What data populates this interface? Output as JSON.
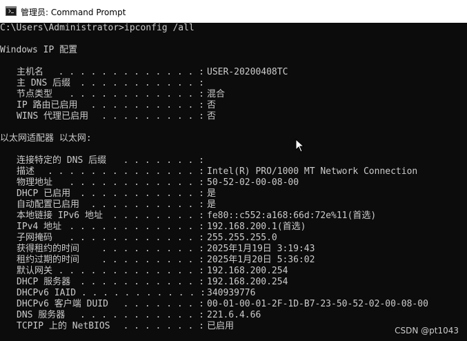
{
  "window": {
    "title": "管理员: Command Prompt",
    "icon": "cmd-icon"
  },
  "console": {
    "command_line": "C:\\Users\\Administrator>ipconfig /all",
    "windows_ip_header": "Windows IP 配置",
    "windows_ip_rows": [
      {
        "key": "主机名",
        "dots": " . . . . . . . . . . . . . :",
        "value": "USER-20200408TC"
      },
      {
        "key": "主 DNS 后缀",
        "dots": " . . . . . . . . . . . :",
        "value": ""
      },
      {
        "key": "节点类型",
        "dots": " . . . . . . . . . . . . :",
        "value": "混合"
      },
      {
        "key": "IP 路由已启用",
        "dots": " . . . . . . . . . . :",
        "value": "否"
      },
      {
        "key": "WINS 代理已启用",
        "dots": " . . . . . . . . . :",
        "value": "否"
      }
    ],
    "adapter_header": "以太网适配器 以太网:",
    "adapter_rows": [
      {
        "key": "连接特定的 DNS 后缀",
        "dots": " . . . . . . . :",
        "value": ""
      },
      {
        "key": "描述",
        "dots": ". . . . . . . . . . . . . . :",
        "value": "Intel(R) PRO/1000 MT Network Connection"
      },
      {
        "key": "物理地址",
        "dots": ". . . . . . . . . . . . :",
        "value": "50-52-02-00-08-00"
      },
      {
        "key": "DHCP 已启用",
        "dots": " . . . . . . . . . . . :",
        "value": "是"
      },
      {
        "key": "自动配置已启用",
        "dots": ". . . . . . . . . . :",
        "value": "是"
      },
      {
        "key": "本地链接 IPv6 地址",
        "dots": ". . . . . . . . :",
        "value": "fe80::c552:a168:66d:72e%11(首选)"
      },
      {
        "key": "IPv4 地址",
        "dots": " . . . . . . . . . . . . :",
        "value": "192.168.200.1(首选)"
      },
      {
        "key": "子网掩码",
        "dots": " . . . . . . . . . . . . :",
        "value": "255.255.255.0"
      },
      {
        "key": "获得租约的时间",
        "dots": " . . . . . . . . . :",
        "value": "2025年1月19日 3:19:43"
      },
      {
        "key": "租约过期的时间",
        "dots": " . . . . . . . . . :",
        "value": "2025年1月20日 5:36:02"
      },
      {
        "key": "默认网关",
        "dots": ". . . . . . . . . . . . . :",
        "value": "192.168.200.254"
      },
      {
        "key": "DHCP 服务器",
        "dots": " . . . . . . . . . . . :",
        "value": "192.168.200.254"
      },
      {
        "key": "DHCPv6 IAID",
        "dots": " . . . . . . . . . . . :",
        "value": "340939776"
      },
      {
        "key": "DHCPv6 客户端 DUID",
        "dots": " . . . . . . . :",
        "value": "00-01-00-01-2F-1D-B7-23-50-52-02-00-08-00"
      },
      {
        "key": "DNS 服务器",
        "dots": " . . . . . . . . . . . :",
        "value": "221.6.4.66"
      },
      {
        "key": "TCPIP 上的 NetBIOS",
        "dots": " . . . . . . . :",
        "value": "已启用"
      }
    ]
  },
  "watermark": "CSDN @pt1043",
  "colors": {
    "console_bg": "#0c0c0c",
    "console_fg": "#cccccc",
    "titlebar_bg": "#ffffff"
  }
}
